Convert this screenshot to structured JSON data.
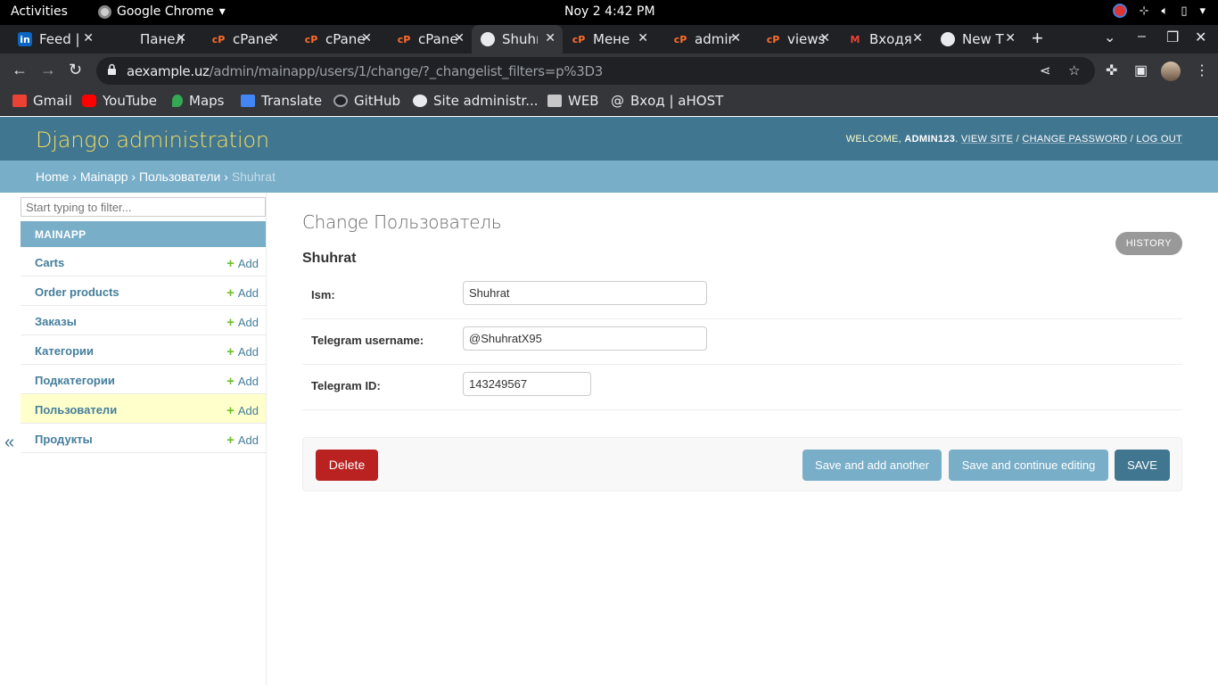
{
  "os_bar": {
    "activities": "Activities",
    "app_name": "Google Chrome",
    "clock": "Noy 2   4:42 PM"
  },
  "tabs": [
    {
      "label": "Feed |",
      "icon": "linkedin-icon",
      "color": "#0a66c2",
      "glyph": "in"
    },
    {
      "label": "Панел",
      "icon": "blank-icon",
      "color": "#202124",
      "glyph": ""
    },
    {
      "label": "cPane",
      "icon": "cpanel-icon",
      "color": "#ff6c2c",
      "glyph": "cP"
    },
    {
      "label": "cPane",
      "icon": "cpanel-icon",
      "color": "#ff6c2c",
      "glyph": "cP"
    },
    {
      "label": "cPane",
      "icon": "cpanel-icon",
      "color": "#ff6c2c",
      "glyph": "cP"
    },
    {
      "label": "Shuhr",
      "icon": "globe-icon",
      "color": "#e8eaed",
      "glyph": ""
    },
    {
      "label": "Мене",
      "icon": "cpanel-icon",
      "color": "#ff6c2c",
      "glyph": "cP"
    },
    {
      "label": "admir",
      "icon": "cpanel-icon",
      "color": "#ff6c2c",
      "glyph": "cP"
    },
    {
      "label": "views",
      "icon": "cpanel-icon",
      "color": "#ff6c2c",
      "glyph": "cP"
    },
    {
      "label": "Входя",
      "icon": "gmail-icon",
      "color": "#ea4335",
      "glyph": "M"
    },
    {
      "label": "New T",
      "icon": "chrome-icon",
      "color": "#e8eaed",
      "glyph": ""
    }
  ],
  "address": {
    "host": "aexample.uz",
    "path": "/admin/mainapp/users/1/change/?_changelist_filters=p%3D3"
  },
  "bookmarks": [
    {
      "label": "Gmail",
      "icon": "gmail-icon",
      "color": "#ea4335"
    },
    {
      "label": "YouTube",
      "icon": "youtube-icon",
      "color": "#ff0000"
    },
    {
      "label": "Maps",
      "icon": "maps-icon",
      "color": "#34a853"
    },
    {
      "label": "Translate",
      "icon": "translate-icon",
      "color": "#4285f4"
    },
    {
      "label": "GitHub",
      "icon": "github-icon",
      "color": "#202124"
    },
    {
      "label": "Site administr...",
      "icon": "globe-icon",
      "color": "#e8eaed"
    },
    {
      "label": "WEB",
      "icon": "folder-icon",
      "color": "#c7c7c7"
    },
    {
      "label": "Вход | aHOST",
      "icon": "at-icon",
      "color": "#e8eaed"
    }
  ],
  "header": {
    "branding": "Django administration",
    "welcome": "Welcome, ",
    "username": "admin123",
    "view_site": "View site",
    "change_password": "Change password",
    "log_out": "Log out"
  },
  "breadcrumbs": {
    "home": "Home",
    "app": "Mainapp",
    "model": "Пользователи",
    "current": "Shuhrat"
  },
  "sidebar": {
    "filter_placeholder": "Start typing to filter...",
    "module": "MAINAPP",
    "add_label": "Add",
    "items": [
      {
        "name": "Carts"
      },
      {
        "name": "Order products"
      },
      {
        "name": "Заказы"
      },
      {
        "name": "Категории"
      },
      {
        "name": "Подкатегории"
      },
      {
        "name": "Пользователи",
        "selected": true
      },
      {
        "name": "Продукты"
      }
    ],
    "toggle": "«"
  },
  "content": {
    "title": "Change Пользователь",
    "history": "HISTORY",
    "object_name": "Shuhrat",
    "fields": [
      {
        "label": "Ism:",
        "value": "Shuhrat"
      },
      {
        "label": "Telegram username:",
        "value": "@ShuhratX95"
      },
      {
        "label": "Telegram ID:",
        "value": "143249567"
      }
    ],
    "buttons": {
      "delete": "Delete",
      "save_add_another": "Save and add another",
      "save_continue": "Save and continue editing",
      "save": "SAVE"
    }
  }
}
